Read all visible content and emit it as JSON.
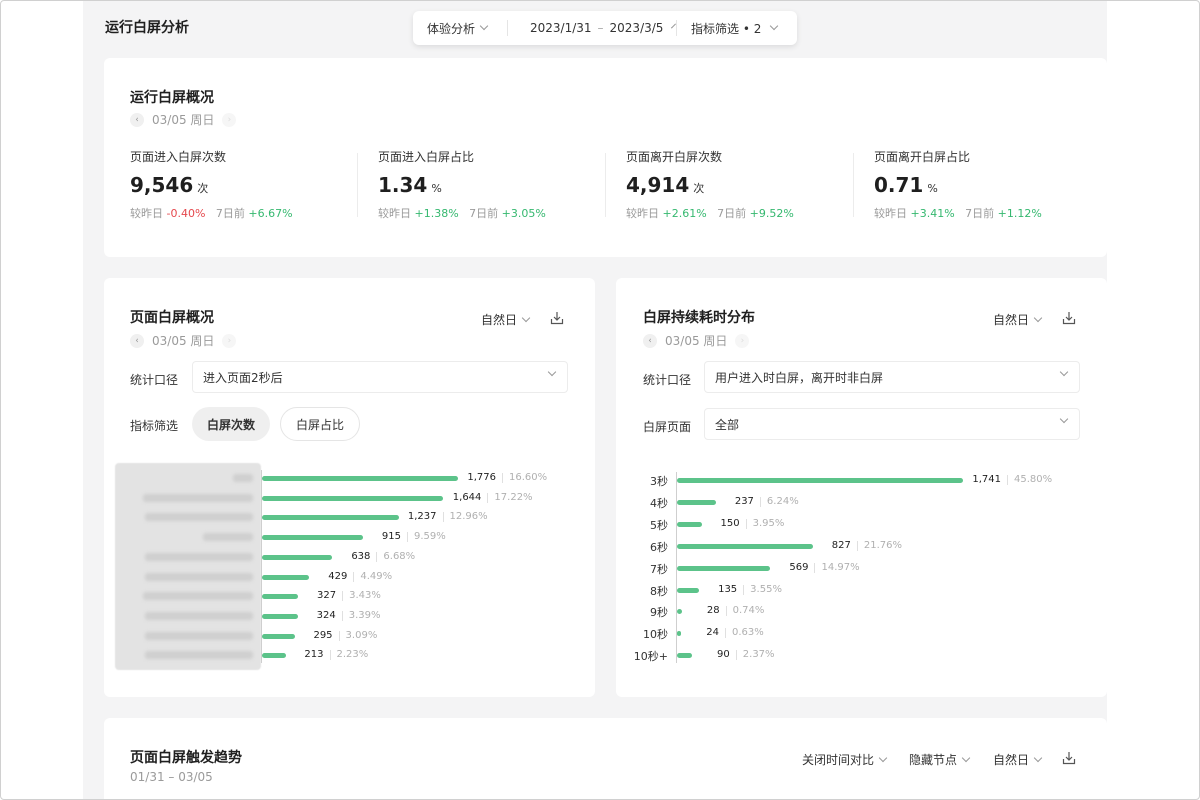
{
  "page": {
    "title": "运行白屏分析"
  },
  "toolbar": {
    "analysis": "体验分析",
    "date_start": "2023/1/31",
    "date_sep": "–",
    "date_end": "2023/3/5",
    "filter": "指标筛选 • 2"
  },
  "overview": {
    "title": "运行白屏概况",
    "date": "03/05 周日",
    "metrics": [
      {
        "label": "页面进入白屏次数",
        "value": "9,546",
        "unit": "次",
        "cmp_day_label": "较昨日",
        "cmp_day": "-0.40%",
        "cmp_week_label": "7日前",
        "cmp_week": "+6.67%"
      },
      {
        "label": "页面进入白屏占比",
        "value": "1.34",
        "unit": "%",
        "cmp_day_label": "较昨日",
        "cmp_day": "+1.38%",
        "cmp_week_label": "7日前",
        "cmp_week": "+3.05%"
      },
      {
        "label": "页面离开白屏次数",
        "value": "4,914",
        "unit": "次",
        "cmp_day_label": "较昨日",
        "cmp_day": "+2.61%",
        "cmp_week_label": "7日前",
        "cmp_week": "+9.52%"
      },
      {
        "label": "页面离开白屏占比",
        "value": "0.71",
        "unit": "%",
        "cmp_day_label": "较昨日",
        "cmp_day": "+3.41%",
        "cmp_week_label": "7日前",
        "cmp_week": "+1.12%"
      }
    ],
    "colors": {
      "up": "#35b86f",
      "down": "#e5484d"
    }
  },
  "page_card": {
    "title": "页面白屏概况",
    "date": "03/05 周日",
    "period": "自然日",
    "stat_label": "统计口径",
    "stat_value": "进入页面2秒后",
    "filter_label": "指标筛选",
    "pill_active": "白屏次数",
    "pill_inactive": "白屏占比"
  },
  "duration_card": {
    "title": "白屏持续耗时分布",
    "date": "03/05 周日",
    "period": "自然日",
    "stat_label": "统计口径",
    "stat_value": "用户进入时白屏，离开时非白屏",
    "page_label": "白屏页面",
    "page_value": "全部"
  },
  "trend_card": {
    "title": "页面白屏触发趋势",
    "date_range": "01/31 – 03/05",
    "compare": "关闭时间对比",
    "hide_nodes": "隐藏节点",
    "period": "自然日"
  },
  "chart_data": [
    {
      "type": "bar",
      "orientation": "horizontal",
      "categories_blurred": true,
      "values": [
        1776,
        1644,
        1237,
        915,
        638,
        429,
        327,
        324,
        295,
        213
      ],
      "value_labels": [
        "1,776",
        "1,644",
        "1,237",
        "915",
        "638",
        "429",
        "327",
        "324",
        "295",
        "213"
      ],
      "percent_labels": [
        "16.60%",
        "17.22%",
        "12.96%",
        "9.59%",
        "6.68%",
        "4.49%",
        "3.43%",
        "3.39%",
        "3.09%",
        "2.23%"
      ],
      "bar_color": "#5cc38a"
    },
    {
      "type": "bar",
      "orientation": "horizontal",
      "categories": [
        "3秒",
        "4秒",
        "5秒",
        "6秒",
        "7秒",
        "8秒",
        "9秒",
        "10秒",
        "10秒+"
      ],
      "values": [
        1741,
        237,
        150,
        827,
        569,
        135,
        28,
        24,
        90
      ],
      "value_labels": [
        "1,741",
        "237",
        "150",
        "827",
        "569",
        "135",
        "28",
        "24",
        "90"
      ],
      "percent_labels": [
        "45.80%",
        "6.24%",
        "3.95%",
        "21.76%",
        "14.97%",
        "3.55%",
        "0.74%",
        "0.63%",
        "2.37%"
      ],
      "bar_color": "#5cc38a"
    }
  ]
}
